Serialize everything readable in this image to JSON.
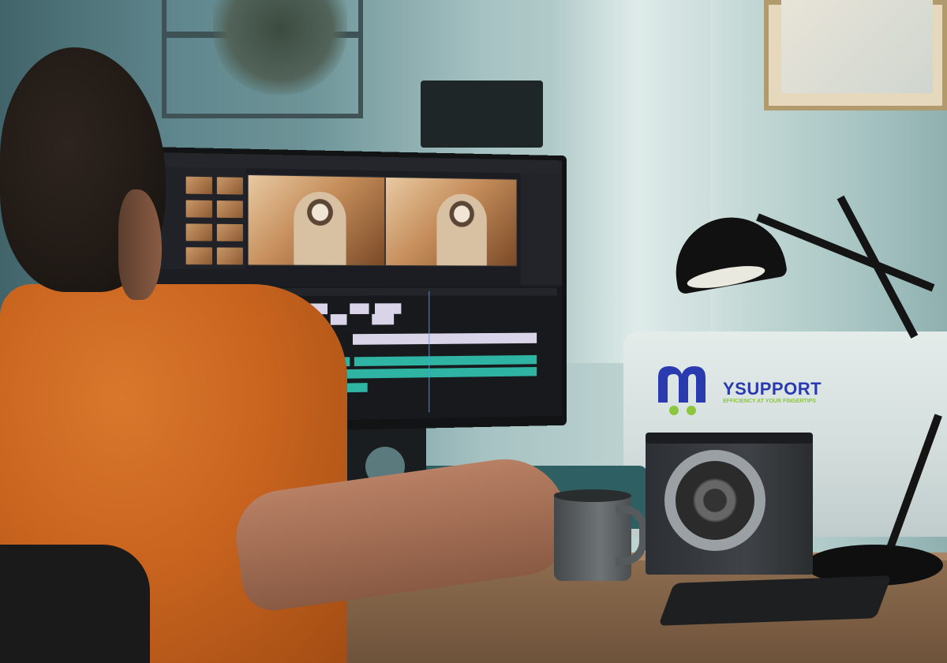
{
  "logo": {
    "wordmark": "YSUPPORT",
    "tagline": "EFFICIENCY AT YOUR FINGERTIPS",
    "primary_color": "#2a3bb0",
    "accent_color": "#8cc63f"
  },
  "editor": {
    "accent_audio_color": "#2fb3a3",
    "accent_video_color": "#d9d4e8"
  }
}
